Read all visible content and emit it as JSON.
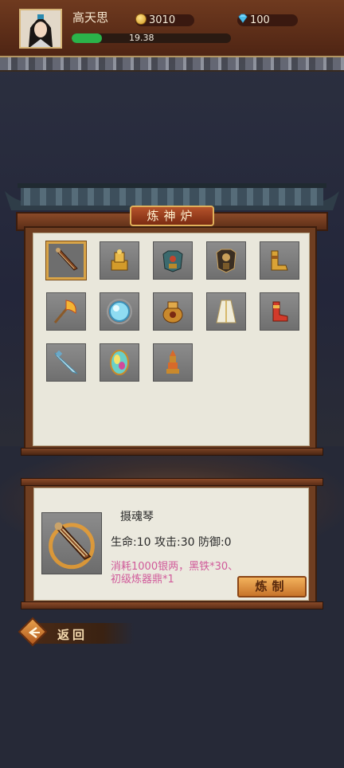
{
  "player": {
    "name": "高天思",
    "coins": "3010",
    "gems": "100",
    "exp_text": "19.38",
    "exp_fraction": 0.19
  },
  "furnace": {
    "title": "炼神炉",
    "items": [
      {
        "name": "lyre-item-icon",
        "selected": true
      },
      {
        "name": "golden-seal-item-icon",
        "selected": false
      },
      {
        "name": "bronze-armor-item-icon",
        "selected": false
      },
      {
        "name": "dark-armor-item-icon",
        "selected": false
      },
      {
        "name": "golden-boots-item-icon",
        "selected": false
      },
      {
        "name": "flame-axe-item-icon",
        "selected": false
      },
      {
        "name": "blue-orb-item-icon",
        "selected": false
      },
      {
        "name": "golden-cauldron-item-icon",
        "selected": false
      },
      {
        "name": "white-robe-item-icon",
        "selected": false
      },
      {
        "name": "red-boots-item-icon",
        "selected": false
      },
      {
        "name": "ice-sword-item-icon",
        "selected": false
      },
      {
        "name": "rainbow-gem-item-icon",
        "selected": false
      },
      {
        "name": "tiered-pagoda-item-icon",
        "selected": false
      }
    ]
  },
  "detail": {
    "name": "摄魂琴",
    "stats": "生命:10 攻击:30 防御:0",
    "cost": "消耗1000银两，黑铁*30、初级炼器鼎*1",
    "craft_label": "炼制"
  },
  "back_label": "返回"
}
